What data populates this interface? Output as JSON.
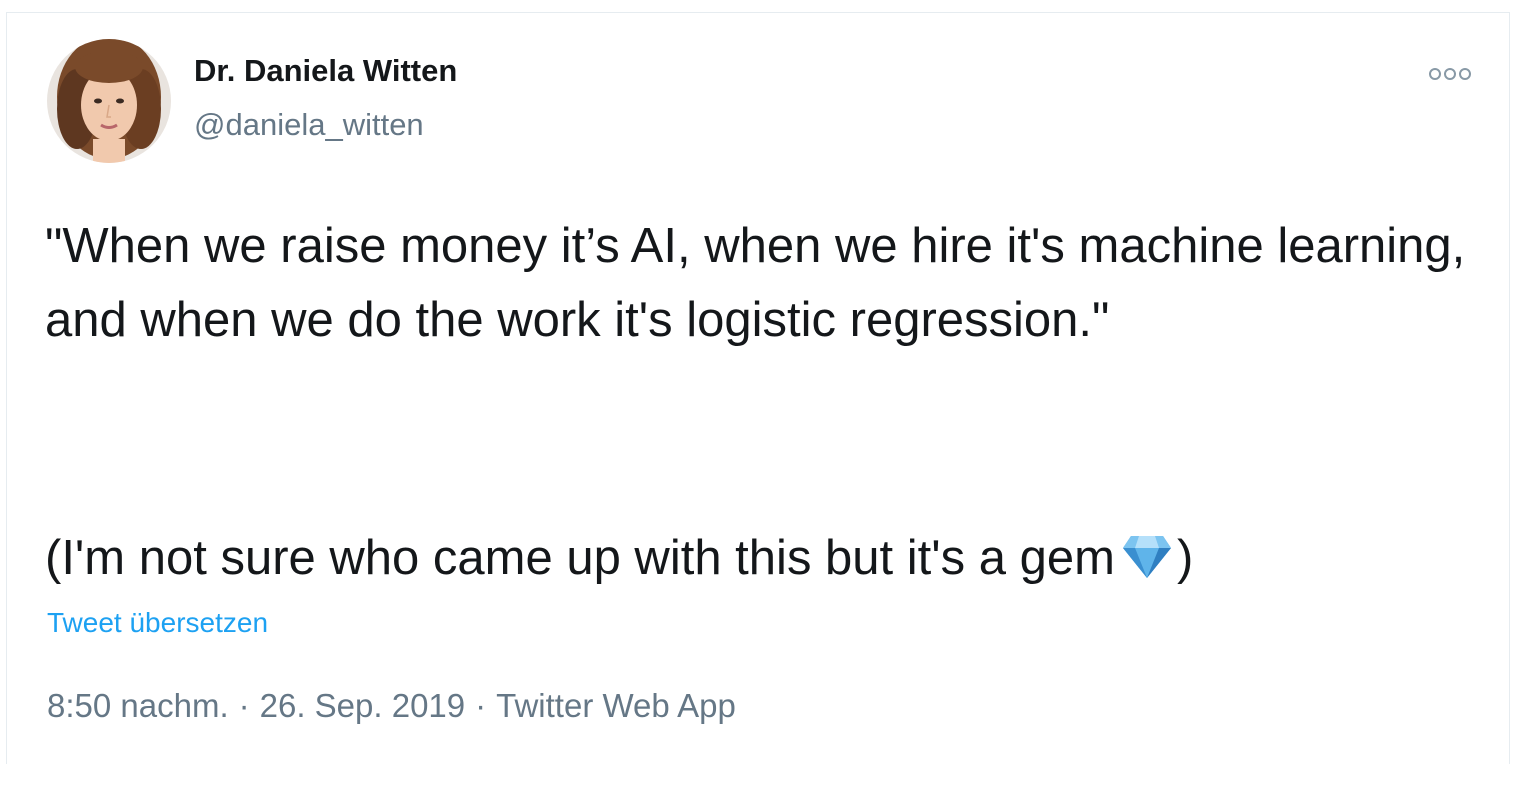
{
  "author": {
    "name": "Dr. Daniela Witten",
    "handle": "@daniela_witten"
  },
  "tweet": {
    "text": "\"When we raise money it’s AI, when we hire it's machine learning, and when we do the work it's logistic regression.\"",
    "text2_before": "(I'm not sure who came up with this but it's a gem",
    "text2_after": ")",
    "emoji": "gem-stone"
  },
  "actions": {
    "translate_label": "Tweet übersetzen"
  },
  "meta": {
    "time": "8:50 nachm.",
    "separator": "·",
    "date": "26. Sep. 2019",
    "client": "Twitter Web App"
  },
  "colors": {
    "text": "#14171a",
    "secondary": "#657786",
    "link": "#1da1f2"
  }
}
